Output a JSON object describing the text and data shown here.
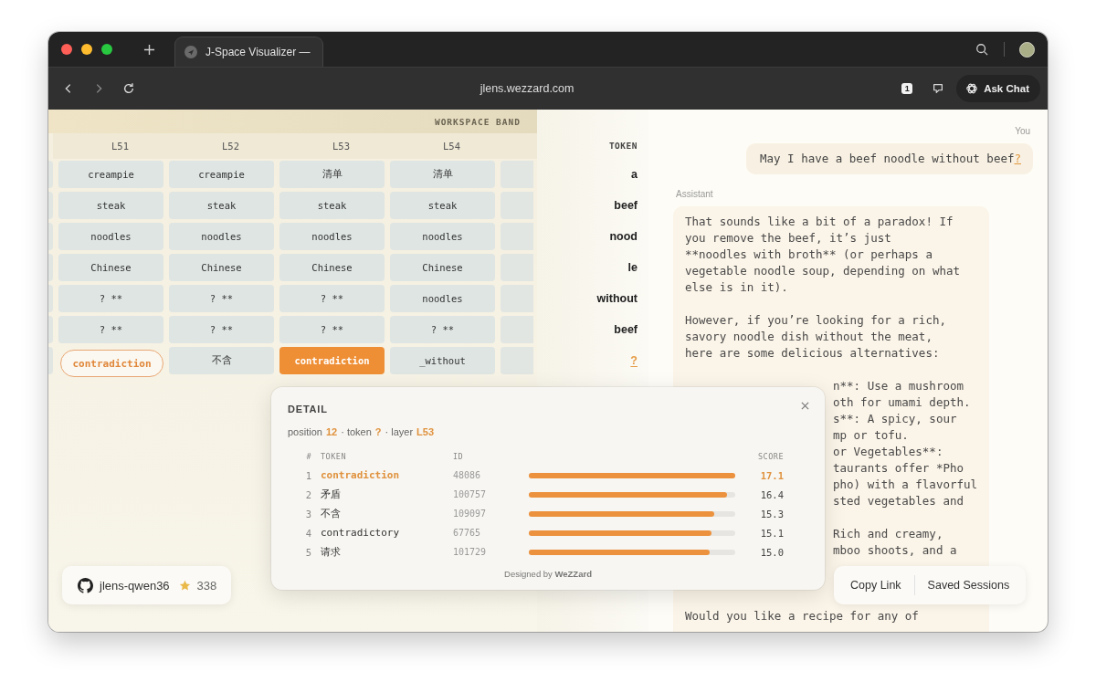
{
  "browser": {
    "tab_title": "J-Space Visualizer —",
    "url": "jlens.wezzard.com",
    "extension_badge": "1",
    "ask_button": "Ask Chat"
  },
  "workspace": {
    "band_label": "WORKSPACE BAND",
    "layers": [
      "L51",
      "L52",
      "L53",
      "L54"
    ],
    "rows": [
      {
        "cells": [
          {
            "text": "creampie",
            "kind": "plain"
          },
          {
            "text": "creampie",
            "kind": "plain"
          },
          {
            "text": "清单",
            "kind": "plain"
          },
          {
            "text": "清单",
            "kind": "plain"
          }
        ]
      },
      {
        "cells": [
          {
            "text": "steak",
            "kind": "plain"
          },
          {
            "text": "steak",
            "kind": "plain"
          },
          {
            "text": "steak",
            "kind": "plain"
          },
          {
            "text": "steak",
            "kind": "plain"
          }
        ]
      },
      {
        "cells": [
          {
            "text": "noodles",
            "kind": "plain"
          },
          {
            "text": "noodles",
            "kind": "plain"
          },
          {
            "text": "noodles",
            "kind": "plain"
          },
          {
            "text": "noodles",
            "kind": "plain"
          }
        ]
      },
      {
        "cells": [
          {
            "text": "Chinese",
            "kind": "plain"
          },
          {
            "text": "Chinese",
            "kind": "plain"
          },
          {
            "text": "Chinese",
            "kind": "plain"
          },
          {
            "text": "Chinese",
            "kind": "plain"
          }
        ]
      },
      {
        "cells": [
          {
            "text": "? **",
            "kind": "plain"
          },
          {
            "text": "? **",
            "kind": "plain"
          },
          {
            "text": "? **",
            "kind": "plain"
          },
          {
            "text": "noodles",
            "kind": "plain"
          }
        ]
      },
      {
        "cells": [
          {
            "text": "? **",
            "kind": "plain"
          },
          {
            "text": "? **",
            "kind": "plain"
          },
          {
            "text": "? **",
            "kind": "plain"
          },
          {
            "text": "? **",
            "kind": "plain"
          }
        ]
      },
      {
        "cells": [
          {
            "text": "contradiction",
            "kind": "outlined"
          },
          {
            "text": "不含",
            "kind": "plain"
          },
          {
            "text": "contradiction",
            "kind": "selected"
          },
          {
            "text": "_without",
            "kind": "plain"
          }
        ]
      }
    ]
  },
  "tokens": {
    "header": "TOKEN",
    "items": [
      {
        "text": "a",
        "selected": false
      },
      {
        "text": "beef",
        "selected": false
      },
      {
        "text": "nood",
        "selected": false
      },
      {
        "text": "le",
        "selected": false
      },
      {
        "text": "without",
        "selected": false
      },
      {
        "text": "beef",
        "selected": false
      },
      {
        "text": "?",
        "selected": true
      }
    ]
  },
  "chat": {
    "user_label": "You",
    "user_text": "May I have a beef noodle without beef",
    "user_token": "?",
    "assistant_label": "Assistant",
    "assistant_lines": [
      {
        "kind": "full",
        "text": "That sounds like a bit of a paradox! If"
      },
      {
        "kind": "full",
        "text": "you remove the beef, it’s just"
      },
      {
        "kind": "full",
        "text": "**noodles with broth** (or perhaps a"
      },
      {
        "kind": "full",
        "text": "vegetable noodle soup, depending on what"
      },
      {
        "kind": "full",
        "text": "else is in it)."
      },
      {
        "kind": "blank"
      },
      {
        "kind": "full",
        "text": "However, if you’re looking for a rich,"
      },
      {
        "kind": "full",
        "text": "savory noodle dish without the meat,"
      },
      {
        "kind": "full",
        "text": "here are some delicious alternatives:"
      },
      {
        "kind": "blank"
      },
      {
        "kind": "tail",
        "text": "n**: Use a mushroom"
      },
      {
        "kind": "tail",
        "text": "oth for umami depth."
      },
      {
        "kind": "tail",
        "text": "s**: A spicy, sour"
      },
      {
        "kind": "tail",
        "text": "mp or tofu."
      },
      {
        "kind": "tail",
        "text": "or Vegetables**:"
      },
      {
        "kind": "tail",
        "text": "taurants offer *Pho"
      },
      {
        "kind": "tail",
        "text": "pho) with a flavorful"
      },
      {
        "kind": "tail",
        "text": "sted vegetables and"
      },
      {
        "kind": "blank"
      },
      {
        "kind": "tail",
        "text": "Rich and creamy,"
      },
      {
        "kind": "tail",
        "text": "mboo shoots, and a"
      },
      {
        "kind": "blank"
      },
      {
        "kind": "blank"
      },
      {
        "kind": "blank"
      },
      {
        "kind": "full",
        "text": "Would you like a recipe for any of"
      }
    ]
  },
  "detail": {
    "title": "DETAIL",
    "meta": [
      {
        "label": "position",
        "value": "12"
      },
      {
        "label": "· token",
        "value": "?"
      },
      {
        "label": "· layer",
        "value": "L53"
      }
    ],
    "columns": [
      "#",
      "TOKEN",
      "ID",
      "SCORE"
    ],
    "rows": [
      {
        "rank": "1",
        "token": "contradiction",
        "id": "48086",
        "level": 1.0,
        "score": "17.1",
        "selected": true
      },
      {
        "rank": "2",
        "token": "矛盾",
        "id": "100757",
        "level": 0.96,
        "score": "16.4",
        "selected": false
      },
      {
        "rank": "3",
        "token": "不含",
        "id": "109097",
        "level": 0.9,
        "score": "15.3",
        "selected": false
      },
      {
        "rank": "4",
        "token": "contradictory",
        "id": "67765",
        "level": 0.885,
        "score": "15.1",
        "selected": false
      },
      {
        "rank": "5",
        "token": "请求",
        "id": "101729",
        "level": 0.875,
        "score": "15.0",
        "selected": false
      }
    ],
    "footer": "Designed by **WeZZard**"
  },
  "repo": {
    "name": "jlens-qwen36",
    "stars": "338"
  },
  "actions": [
    "Copy Link",
    "Saved Sessions"
  ]
}
